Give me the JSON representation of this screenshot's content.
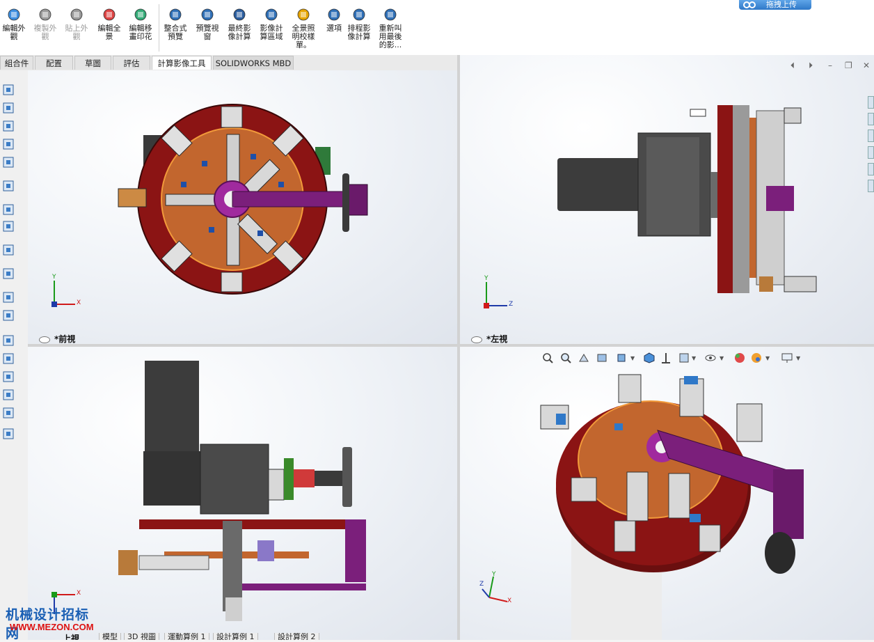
{
  "toolbar": {
    "buttons": [
      {
        "label": "編輯外\n觀",
        "icon": "edit-appearance-icon",
        "enabled": true
      },
      {
        "label": "複製外\n觀",
        "icon": "copy-appearance-icon",
        "enabled": false
      },
      {
        "label": "貼上外\n觀",
        "icon": "paste-appearance-icon",
        "enabled": false
      },
      {
        "label": "編輯全\n景",
        "icon": "edit-scene-icon",
        "enabled": true
      },
      {
        "label": "編輯移\n畫印花",
        "icon": "edit-decal-icon",
        "enabled": true
      },
      {
        "label": "整合式\n預覽",
        "icon": "integrated-preview-icon",
        "enabled": true
      },
      {
        "label": "預覽視\n窗",
        "icon": "preview-window-icon",
        "enabled": true
      },
      {
        "label": "最終影\n像計算",
        "icon": "final-render-icon",
        "enabled": true
      },
      {
        "label": "影像計\n算區域",
        "icon": "render-region-icon",
        "enabled": true
      },
      {
        "label": "全景照\n明校樣\n單。",
        "icon": "illumination-proof-icon",
        "enabled": true
      },
      {
        "label": "選項",
        "icon": "options-icon",
        "enabled": true
      },
      {
        "label": "排程影\n像計算",
        "icon": "schedule-render-icon",
        "enabled": true
      },
      {
        "label": "重新叫\n用最後\n的影...",
        "icon": "recall-last-render-icon",
        "enabled": true
      }
    ],
    "cloud_button": "拖拽上传"
  },
  "tabs": [
    {
      "label": "組合件",
      "active": false
    },
    {
      "label": "配置",
      "active": false
    },
    {
      "label": "草圖",
      "active": false
    },
    {
      "label": "評估",
      "active": false
    },
    {
      "label": "計算影像工具",
      "active": true
    },
    {
      "label": "SOLIDWORKS MBD",
      "active": false
    }
  ],
  "viewports": {
    "front": {
      "label": "*前視"
    },
    "left": {
      "label": "*左視"
    },
    "top": {
      "label": "上視"
    },
    "iso": {
      "label": ""
    }
  },
  "axes": {
    "x": "X",
    "y": "Y",
    "z": "Z"
  },
  "bottom_tabs": [
    "模型",
    "3D 視圖",
    "運動算例 1",
    "設計算例 1",
    "設計算例 2"
  ],
  "watermark": {
    "line1": "机械设计招标网",
    "line2": "WWW.MEZON.COM"
  },
  "colors": {
    "turntable_red": "#8b1414",
    "plate_orange": "#c2662e",
    "hub_purple": "#a02a9e",
    "motor_dark": "#3d3d3d",
    "accent_blue": "#2f78c8"
  }
}
